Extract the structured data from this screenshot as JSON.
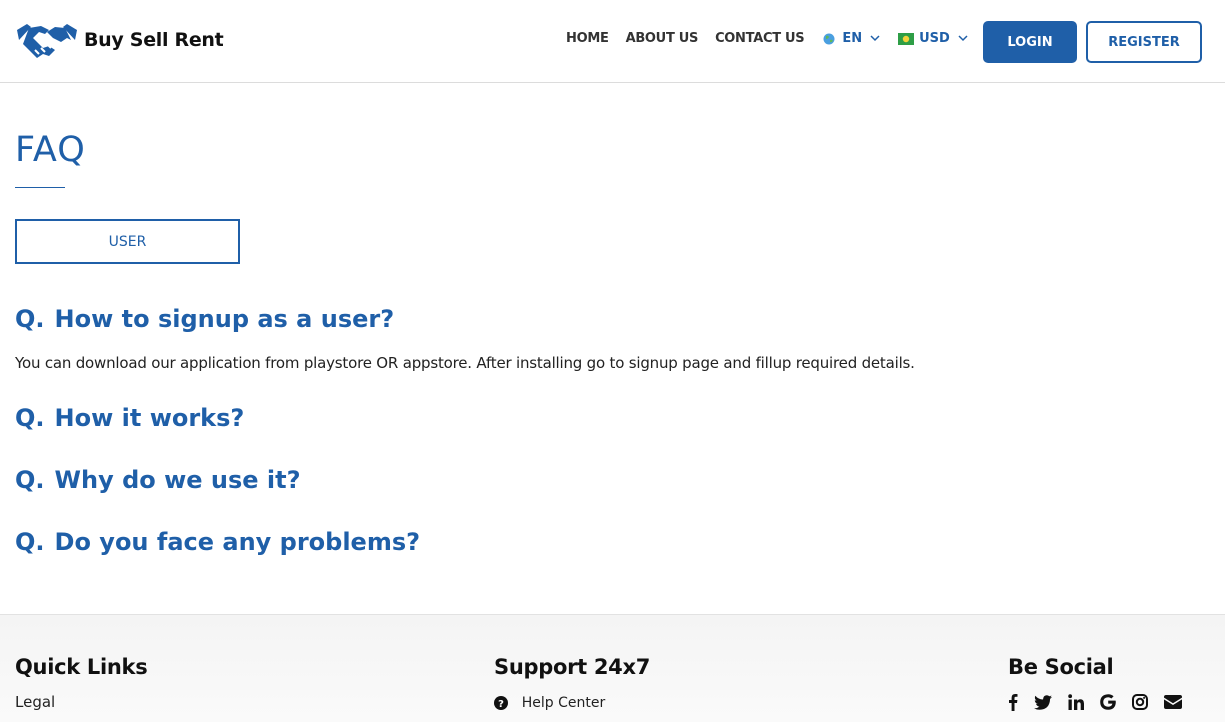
{
  "brand": {
    "name": "Buy Sell Rent"
  },
  "nav": {
    "links": [
      "HOME",
      "ABOUT US",
      "CONTACT US"
    ],
    "language": "EN",
    "currency": "USD",
    "login": "LOGIN",
    "register": "REGISTER"
  },
  "faq": {
    "title": "FAQ",
    "tab": "USER",
    "q_prefix": "Q.",
    "items": [
      {
        "question": "How to signup as a user?",
        "answer": "You can download our application from playstore OR appstore. After installing go to signup page and fillup required details."
      },
      {
        "question": "How it works?"
      },
      {
        "question": "Why do we use it?"
      },
      {
        "question": "Do you face any problems?"
      }
    ]
  },
  "footer": {
    "quick_links": {
      "heading": "Quick Links",
      "items": [
        "Legal"
      ]
    },
    "support": {
      "heading": "Support 24x7",
      "items": [
        "Help Center"
      ]
    },
    "social": {
      "heading": "Be Social",
      "icons": [
        "facebook-icon",
        "twitter-icon",
        "linkedin-icon",
        "google-icon",
        "instagram-icon",
        "email-icon"
      ]
    }
  },
  "colors": {
    "accent": "#1f5fa8"
  }
}
